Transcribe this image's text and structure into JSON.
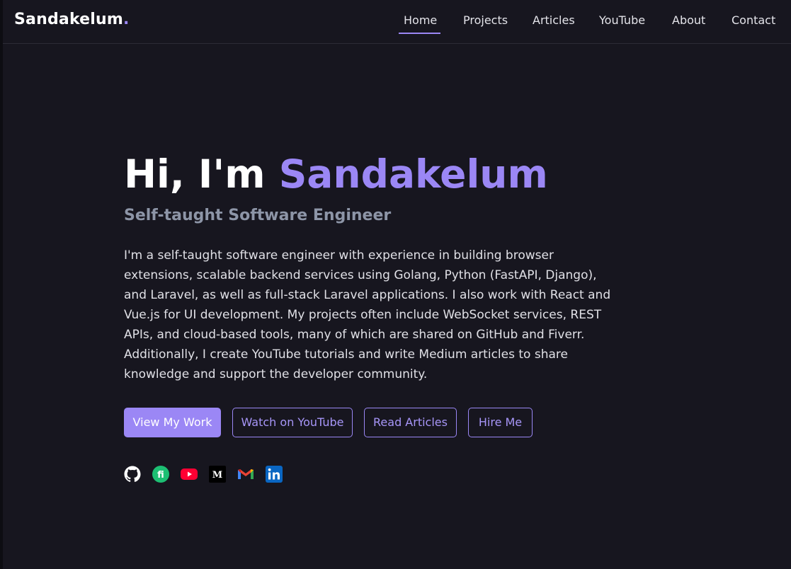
{
  "brand": {
    "name": "Sandakelum",
    "dot": "."
  },
  "nav": {
    "items": [
      {
        "label": "Home",
        "active": true
      },
      {
        "label": "Projects"
      },
      {
        "label": "Articles"
      },
      {
        "label": "YouTube"
      },
      {
        "label": "About"
      },
      {
        "label": "Contact"
      }
    ]
  },
  "hero": {
    "greeting": "Hi, I'm ",
    "name": "Sandakelum",
    "subtitle": "Self-taught Software Engineer",
    "bio": "I'm a self-taught software engineer with experience in building browser extensions, scalable backend services using Golang, Python (FastAPI, Django), and Laravel, as well as full-stack Laravel applications. I also work with React and Vue.js for UI development. My projects often include WebSocket services, REST APIs, and cloud-based tools, many of which are shared on GitHub and Fiverr. Additionally, I create YouTube tutorials and write Medium articles to share knowledge and support the developer community."
  },
  "buttons": {
    "view_work": "View My Work",
    "youtube": "Watch on YouTube",
    "articles": "Read Articles",
    "hire": "Hire Me"
  },
  "socials": [
    {
      "icon": "github-icon"
    },
    {
      "icon": "fiverr-icon"
    },
    {
      "icon": "youtube-icon"
    },
    {
      "icon": "medium-icon"
    },
    {
      "icon": "gmail-icon"
    },
    {
      "icon": "linkedin-icon"
    }
  ],
  "colors": {
    "accent": "#9b87f5",
    "background": "#17161f",
    "fiverr": "#1dbf73",
    "youtube": "#ff0033",
    "linkedin": "#0a66c2"
  }
}
